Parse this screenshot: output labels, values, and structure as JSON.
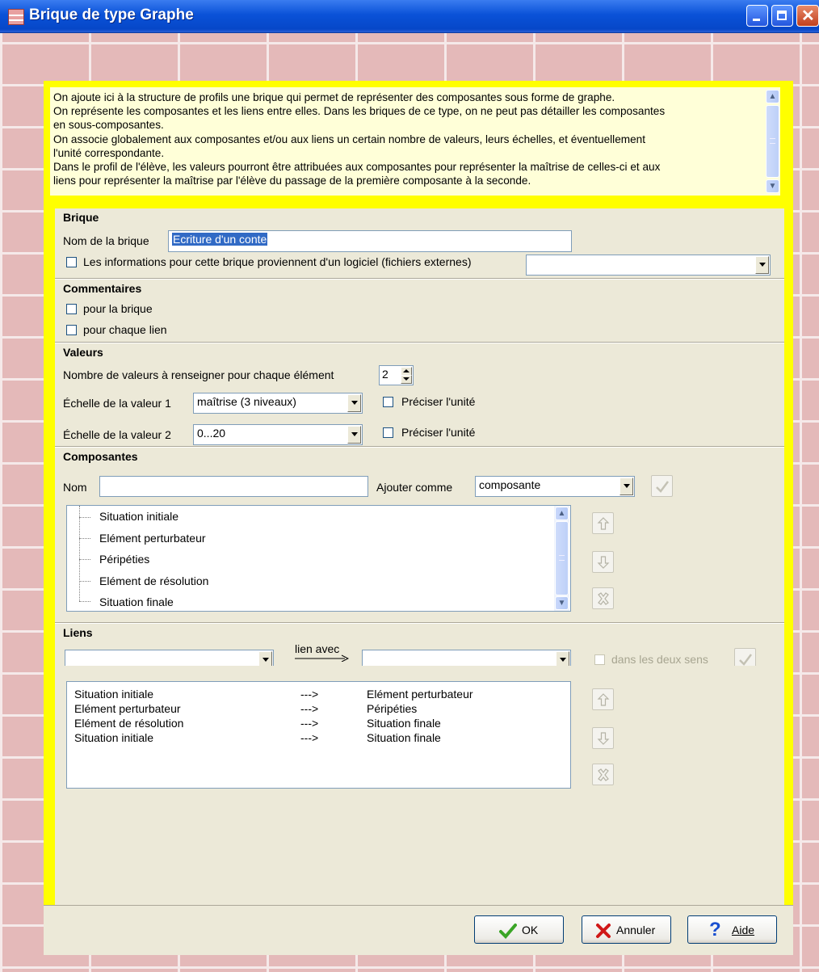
{
  "window": {
    "title": "Brique de type Graphe"
  },
  "description": {
    "lines": [
      "On ajoute ici à la structure de profils une brique qui permet de représenter des composantes sous forme de graphe.",
      "On représente les composantes et les liens entre elles. Dans les briques de ce type, on ne peut pas détailler les composantes",
      "en sous-composantes.",
      "On associe globalement aux composantes et/ou aux liens  un certain nombre de valeurs, leurs échelles, et éventuellement",
      "l'unité correspondante.",
      "Dans le profil de l'élève, les valeurs pourront être attribuées aux composantes pour représenter la maîtrise de celles-ci et aux",
      "liens pour représenter la maîtrise par l'élève du passage de la première composante à la seconde."
    ]
  },
  "brique": {
    "heading": "Brique",
    "name_label": "Nom de la brique",
    "name_value": "Ecriture d'un conte",
    "external_label": "Les informations pour cette brique proviennent d'un logiciel (fichiers externes)",
    "external_value": ""
  },
  "commentaires": {
    "heading": "Commentaires",
    "brique_label": "pour la brique",
    "lien_label": "pour chaque lien"
  },
  "valeurs": {
    "heading": "Valeurs",
    "count_label": "Nombre de valeurs à renseigner pour chaque élément",
    "count_value": "2",
    "scale1_label": "Échelle de la valeur 1",
    "scale1_value": "maîtrise (3 niveaux)",
    "scale2_label": "Échelle de la valeur 2",
    "scale2_value": "0...20",
    "unit_label": "Préciser l'unité"
  },
  "composantes": {
    "heading": "Composantes",
    "nom_label": "Nom",
    "nom_value": "",
    "add_as_label": "Ajouter comme",
    "add_as_value": "composante",
    "items": [
      "Situation initiale",
      "Elément perturbateur",
      "Péripéties",
      "Elément de résolution",
      "Situation finale"
    ]
  },
  "liens": {
    "heading": "Liens",
    "from_value": "",
    "link_label": "lien avec",
    "to_value": "",
    "both_label": "dans les deux sens",
    "rows": [
      {
        "from": "Situation initiale",
        "arrow": "--->",
        "to": "Elément perturbateur"
      },
      {
        "from": "Elément perturbateur",
        "arrow": "--->",
        "to": "Péripéties"
      },
      {
        "from": "Elément de résolution",
        "arrow": "--->",
        "to": "Situation finale"
      },
      {
        "from": "Situation initiale",
        "arrow": "--->",
        "to": "Situation finale"
      }
    ]
  },
  "buttons": {
    "ok": "OK",
    "cancel": "Annuler",
    "help": "Aide"
  },
  "colors": {
    "frame": "#ffff00",
    "titlebar": "#0a52d8",
    "panel": "#ece9d8",
    "ok_icon": "#3aa526",
    "cancel_icon": "#d01818",
    "help_icon": "#1a50d0"
  },
  "icons": [
    "window-app-icon",
    "minimize-icon",
    "maximize-icon",
    "close-icon",
    "checkmark-icon",
    "arrow-up-icon",
    "arrow-down-icon",
    "delete-icon",
    "help-question-icon"
  ]
}
